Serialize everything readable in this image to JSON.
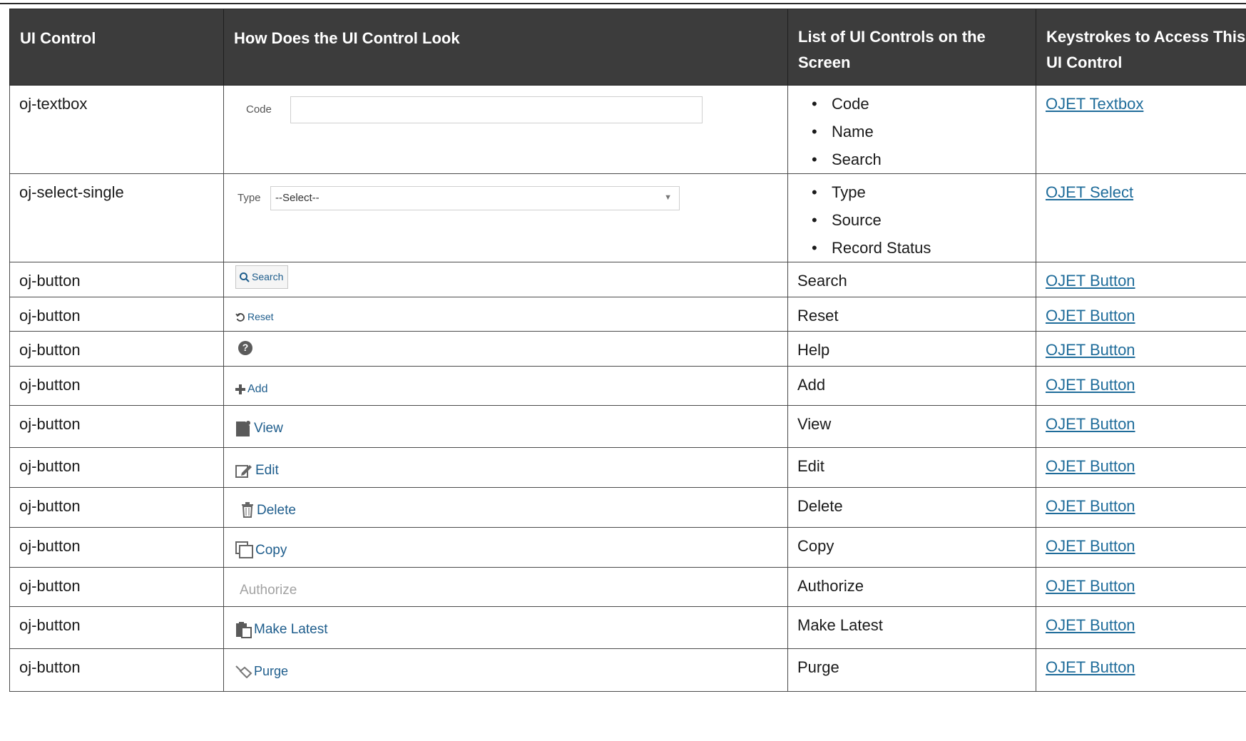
{
  "headers": {
    "c1": "UI Control",
    "c2": "How Does the UI Control Look",
    "c3": "List of UI Controls on the Screen",
    "c4": "Keystrokes to Access This UI Control"
  },
  "rows": [
    {
      "control": "oj-textbox",
      "preview": {
        "label": "Code"
      },
      "list": [
        "Code",
        "Name",
        "Search"
      ],
      "link": "OJET Textbox"
    },
    {
      "control": "oj-select-single",
      "preview": {
        "label": "Type",
        "value": "--Select--"
      },
      "list": [
        "Type",
        "Source",
        "Record Status"
      ],
      "link": "OJET Select"
    },
    {
      "control": "oj-button",
      "preview": {
        "label": "Search",
        "icon": "search-icon"
      },
      "text": "Search",
      "link": "OJET Button"
    },
    {
      "control": "oj-button",
      "preview": {
        "label": "Reset",
        "icon": "reset-icon"
      },
      "text": "Reset",
      "link": "OJET Button"
    },
    {
      "control": "oj-button",
      "preview": {
        "icon": "help-icon"
      },
      "text": "Help",
      "link": "OJET Button"
    },
    {
      "control": "oj-button",
      "preview": {
        "label": "Add",
        "icon": "plus-icon"
      },
      "text": "Add",
      "link": "OJET Button"
    },
    {
      "control": "oj-button",
      "preview": {
        "label": "View",
        "icon": "document-icon"
      },
      "text": "View",
      "link": "OJET Button"
    },
    {
      "control": "oj-button",
      "preview": {
        "label": "Edit",
        "icon": "edit-icon"
      },
      "text": "Edit",
      "link": "OJET Button"
    },
    {
      "control": "oj-button",
      "preview": {
        "label": "Delete",
        "icon": "trash-icon"
      },
      "text": "Delete",
      "link": "OJET Button"
    },
    {
      "control": "oj-button",
      "preview": {
        "label": "Copy",
        "icon": "copy-icon"
      },
      "text": "Copy",
      "link": "OJET Button"
    },
    {
      "control": "oj-button",
      "preview": {
        "label": "Authorize"
      },
      "text": "Authorize",
      "link": "OJET Button"
    },
    {
      "control": "oj-button",
      "preview": {
        "label": "Make Latest",
        "icon": "clipboard-icon"
      },
      "text": "Make Latest",
      "link": "OJET Button"
    },
    {
      "control": "oj-button",
      "preview": {
        "label": "Purge",
        "icon": "eraser-icon"
      },
      "text": "Purge",
      "link": "OJET Button"
    }
  ]
}
